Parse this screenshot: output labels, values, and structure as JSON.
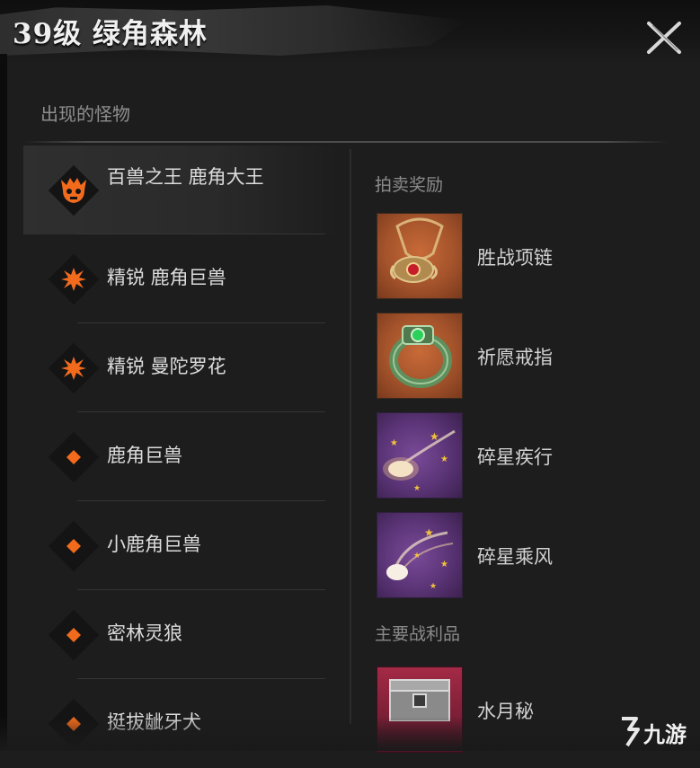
{
  "window": {
    "title": "39级 绿角森林"
  },
  "monsters_section": {
    "heading": "出现的怪物",
    "items": [
      {
        "name": "百兽之王 鹿角大王",
        "icon": "boss-skull-icon",
        "selected": true
      },
      {
        "name": "精锐 鹿角巨兽",
        "icon": "elite-star-icon"
      },
      {
        "name": "精锐 曼陀罗花",
        "icon": "elite-star-icon"
      },
      {
        "name": "鹿角巨兽",
        "icon": "normal-diamond-icon"
      },
      {
        "name": "小鹿角巨兽",
        "icon": "normal-diamond-icon"
      },
      {
        "name": "密林灵狼",
        "icon": "normal-diamond-icon"
      },
      {
        "name": "挺拔龇牙犬",
        "icon": "normal-diamond-icon"
      }
    ]
  },
  "rewards_section": {
    "auction_heading": "拍卖奖励",
    "auction_items": [
      {
        "name": "胜战项链",
        "icon": "necklace-icon"
      },
      {
        "name": "祈愿戒指",
        "icon": "ring-icon"
      },
      {
        "name": "碎星疾行",
        "icon": "comet-skill-icon"
      },
      {
        "name": "碎星乘风",
        "icon": "comet-wind-skill-icon"
      }
    ],
    "loot_heading": "主要战利品",
    "loot_items": [
      {
        "name": "水月秘",
        "icon": "chest-icon"
      }
    ]
  },
  "colors": {
    "accent": "#f26b1d",
    "background": "#1d1d1d"
  },
  "watermark": {
    "text": "九游"
  }
}
